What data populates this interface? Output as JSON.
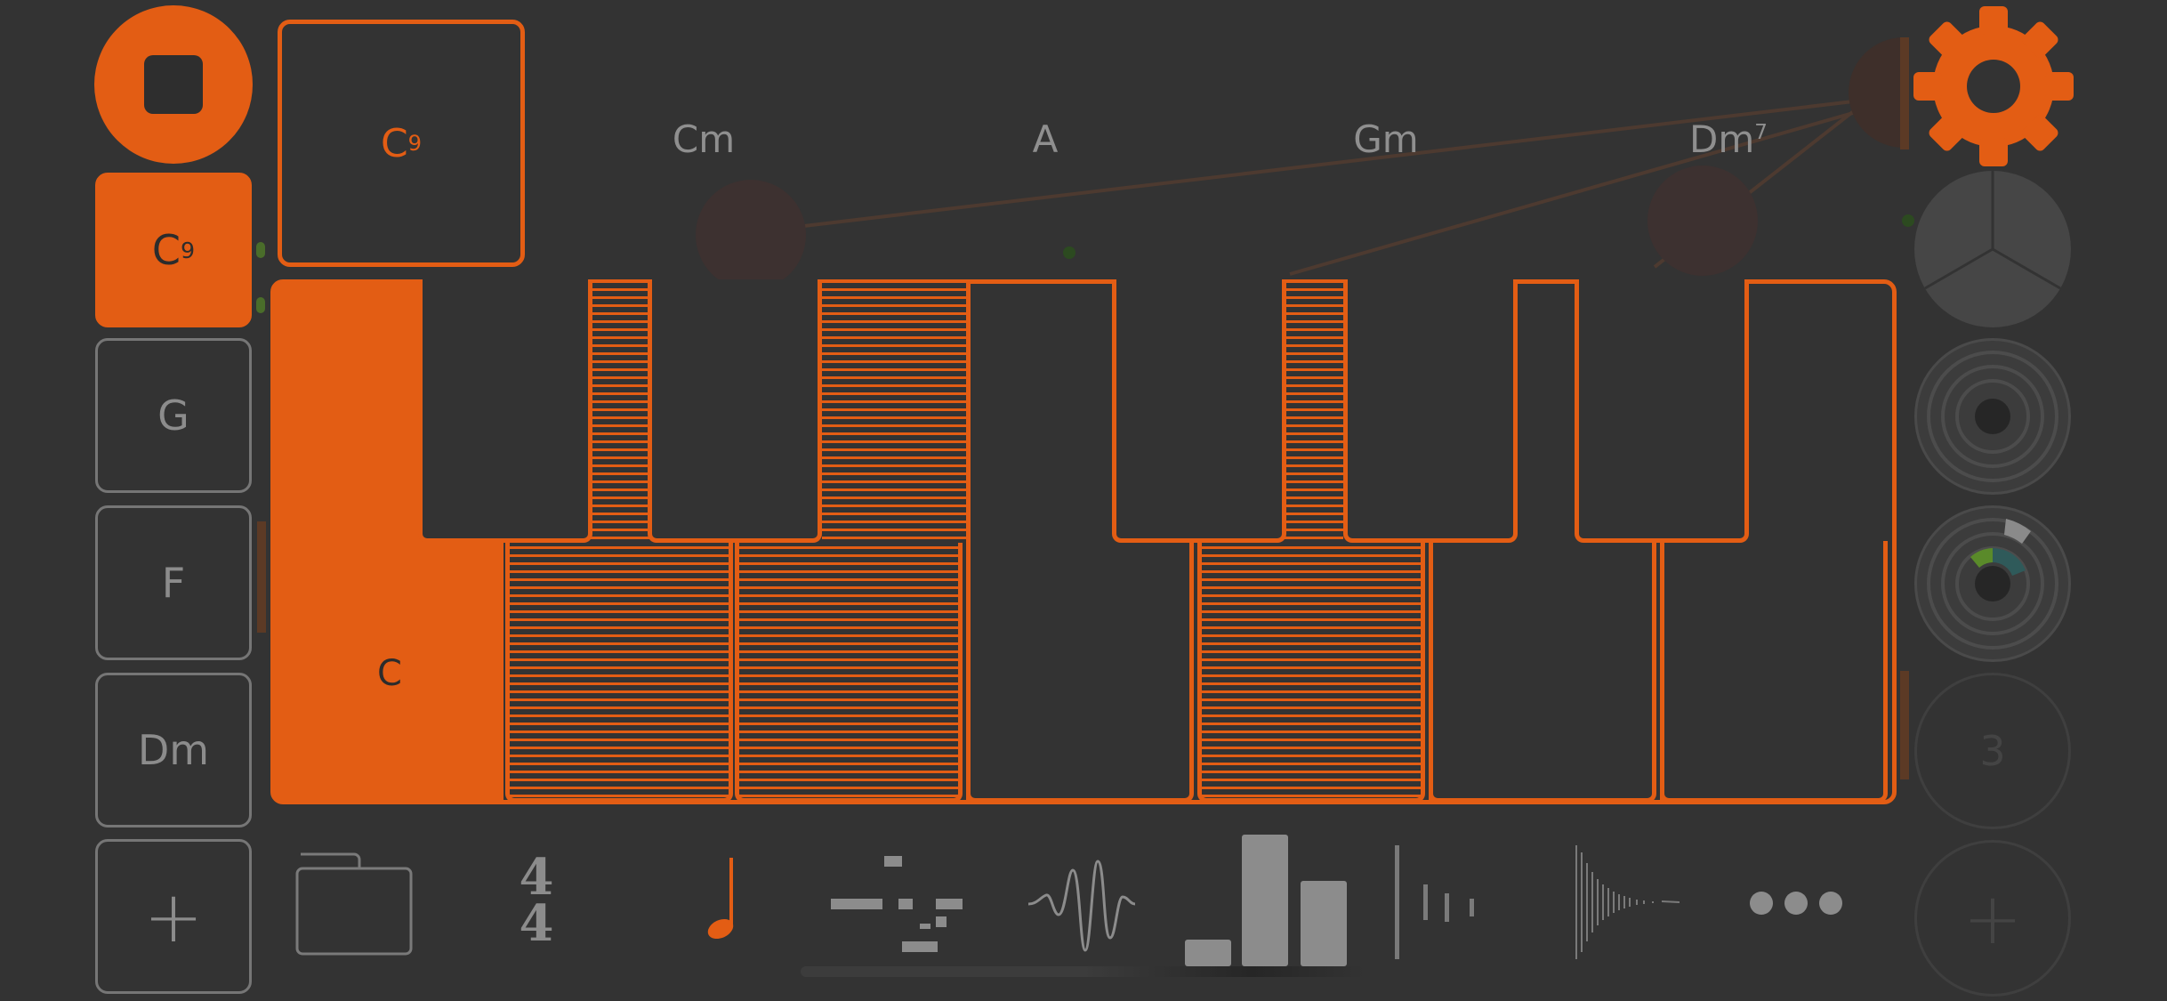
{
  "colors": {
    "accent": "#e35d14",
    "background": "#333333",
    "outline": "#767676",
    "text_muted": "#8f8f8f"
  },
  "left_chords": [
    {
      "root": "C",
      "sup": "9",
      "active": true
    },
    {
      "root": "G",
      "sup": "",
      "active": false
    },
    {
      "root": "F",
      "sup": "",
      "active": false
    },
    {
      "root": "Dm",
      "sup": "",
      "active": false
    }
  ],
  "add_label": "+",
  "current_chord": {
    "root": "C",
    "sup": "9"
  },
  "top_chords": [
    {
      "root": "Cm",
      "sup": ""
    },
    {
      "root": "A",
      "sup": ""
    },
    {
      "root": "Gm",
      "sup": ""
    },
    {
      "root": "Dm",
      "sup": "7"
    }
  ],
  "keyboard": {
    "pressed_key_label": "C"
  },
  "time_signature": {
    "top": "4",
    "bottom": "4"
  },
  "right_panel": {
    "count_label": "3",
    "add_label": "+"
  },
  "icons": [
    "stop-icon",
    "gear-icon",
    "folder-icon",
    "time-signature-icon",
    "note-icon",
    "pattern-icon",
    "waveform-icon",
    "bars-icon",
    "envelope-icon",
    "decay-icon",
    "more-icon"
  ]
}
